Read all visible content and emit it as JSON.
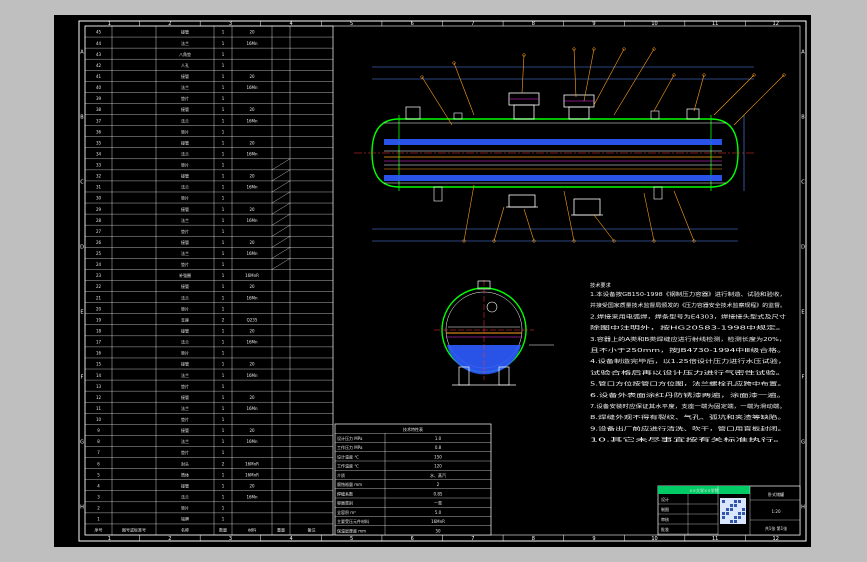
{
  "frame": {
    "columns": [
      "1",
      "2",
      "3",
      "4",
      "5",
      "6",
      "7",
      "8",
      "9",
      "10",
      "11",
      "12"
    ],
    "rows": [
      "A",
      "B",
      "C",
      "D",
      "E",
      "F",
      "G",
      "H"
    ]
  },
  "bom": {
    "header": [
      "序号",
      "图号或标准号",
      "名称",
      "数量",
      "材料",
      "重量",
      "备注"
    ],
    "rows": [
      [
        "45",
        "",
        "接管",
        "1",
        "20",
        "",
        ""
      ],
      [
        "44",
        "",
        "法兰",
        "1",
        "16Mn",
        "",
        ""
      ],
      [
        "43",
        "",
        "八角垫",
        "1",
        "",
        "",
        ""
      ],
      [
        "42",
        "",
        "人孔",
        "1",
        "",
        "",
        ""
      ],
      [
        "41",
        "",
        "接管",
        "1",
        "20",
        "",
        ""
      ],
      [
        "40",
        "",
        "法兰",
        "1",
        "16Mn",
        "",
        ""
      ],
      [
        "39",
        "",
        "垫片",
        "1",
        "",
        "",
        ""
      ],
      [
        "38",
        "",
        "接管",
        "1",
        "20",
        "",
        ""
      ],
      [
        "37",
        "",
        "法兰",
        "1",
        "16Mn",
        "",
        ""
      ],
      [
        "36",
        "",
        "垫片",
        "1",
        "",
        "",
        ""
      ],
      [
        "35",
        "",
        "接管",
        "1",
        "20",
        "",
        ""
      ],
      [
        "34",
        "",
        "法兰",
        "1",
        "16Mn",
        "",
        ""
      ],
      [
        "33",
        "",
        "垫片",
        "1",
        "",
        "",
        ""
      ],
      [
        "32",
        "",
        "接管",
        "1",
        "20",
        "",
        ""
      ],
      [
        "31",
        "",
        "法兰",
        "1",
        "16Mn",
        "",
        ""
      ],
      [
        "30",
        "",
        "垫片",
        "1",
        "",
        "",
        ""
      ],
      [
        "29",
        "",
        "接管",
        "1",
        "20",
        "",
        ""
      ],
      [
        "28",
        "",
        "法兰",
        "1",
        "16Mn",
        "",
        ""
      ],
      [
        "27",
        "",
        "垫片",
        "1",
        "",
        "",
        ""
      ],
      [
        "26",
        "",
        "接管",
        "1",
        "20",
        "",
        ""
      ],
      [
        "25",
        "",
        "法兰",
        "1",
        "16Mn",
        "",
        ""
      ],
      [
        "24",
        "",
        "垫片",
        "1",
        "",
        "",
        ""
      ],
      [
        "23",
        "",
        "补强圈",
        "1",
        "16MnR",
        "",
        ""
      ],
      [
        "22",
        "",
        "接管",
        "1",
        "20",
        "",
        ""
      ],
      [
        "21",
        "",
        "法兰",
        "1",
        "16Mn",
        "",
        ""
      ],
      [
        "20",
        "",
        "垫片",
        "1",
        "",
        "",
        ""
      ],
      [
        "19",
        "",
        "支座",
        "2",
        "Q235",
        "",
        ""
      ],
      [
        "18",
        "",
        "接管",
        "1",
        "20",
        "",
        ""
      ],
      [
        "17",
        "",
        "法兰",
        "1",
        "16Mn",
        "",
        ""
      ],
      [
        "16",
        "",
        "垫片",
        "1",
        "",
        "",
        ""
      ],
      [
        "15",
        "",
        "接管",
        "1",
        "20",
        "",
        ""
      ],
      [
        "14",
        "",
        "法兰",
        "1",
        "16Mn",
        "",
        ""
      ],
      [
        "13",
        "",
        "垫片",
        "1",
        "",
        "",
        ""
      ],
      [
        "12",
        "",
        "接管",
        "1",
        "20",
        "",
        ""
      ],
      [
        "11",
        "",
        "法兰",
        "1",
        "16Mn",
        "",
        ""
      ],
      [
        "10",
        "",
        "垫片",
        "1",
        "",
        "",
        ""
      ],
      [
        "9",
        "",
        "接管",
        "1",
        "20",
        "",
        ""
      ],
      [
        "8",
        "",
        "法兰",
        "1",
        "16Mn",
        "",
        ""
      ],
      [
        "7",
        "",
        "垫片",
        "1",
        "",
        "",
        ""
      ],
      [
        "6",
        "",
        "封头",
        "2",
        "16MnR",
        "",
        ""
      ],
      [
        "5",
        "",
        "筒体",
        "1",
        "16MnR",
        "",
        ""
      ],
      [
        "4",
        "",
        "接管",
        "1",
        "20",
        "",
        ""
      ],
      [
        "3",
        "",
        "法兰",
        "1",
        "16Mn",
        "",
        ""
      ],
      [
        "2",
        "",
        "垫片",
        "1",
        "",
        "",
        ""
      ],
      [
        "1",
        "",
        "铭牌",
        "1",
        "",
        "",
        ""
      ]
    ]
  },
  "notes": {
    "title": "技术要求",
    "lines": [
      "1.本设备按GB150-1998《钢制压力容器》进行制造、试验和验收，",
      "  并接受国家质量技术监督局颁发的《压力容器安全技术监察规程》的监督。",
      "2.焊接采用电弧焊，焊条型号为E4303，焊接接头型式及尺寸",
      "  除图中注明外，按HG20583-1998中规定。",
      "3.容器上的A类和B类焊缝应进行射线检测，检测长度为20%，",
      "  且不小于250mm，按JB4730-1994中Ⅲ级合格。",
      "4.设备制造完毕后，以1.25倍设计压力进行水压试验，",
      "  试验合格后再以设计压力进行气密性试验。",
      "5.管口方位按管口方位图，法兰螺栓孔应跨中布置。",
      "6.设备外表面涂红丹防锈漆两遍，涂面漆一遍。",
      "7.设备安装时应保证其水平度，支座一端为固定端，一端为滑动端。",
      "8.焊缝外观不得有裂纹、气孔、弧坑和夹渣等缺陷。",
      "9.设备出厂前应进行清洗、吹干，管口用盲板封闭。",
      "10.其它未尽事宜按有关标准执行。"
    ]
  },
  "spec": {
    "title": "技术特性表",
    "rows": [
      [
        "设计压力 MPa",
        "1.0"
      ],
      [
        "工作压力 MPa",
        "0.8"
      ],
      [
        "设计温度 ℃",
        "150"
      ],
      [
        "工作温度 ℃",
        "120"
      ],
      [
        "介质",
        "水、蒸汽"
      ],
      [
        "腐蚀裕量 mm",
        "2"
      ],
      [
        "焊缝系数",
        "0.85"
      ],
      [
        "容器类别",
        "一类"
      ],
      [
        "全容积 m³",
        "5.0"
      ],
      [
        "主要受压元件材料",
        "16MnR"
      ],
      [
        "保温层厚度 mm",
        "50"
      ]
    ]
  },
  "titleblock": {
    "header": "××大学××学院",
    "drawing_title": "卧式储罐",
    "scale": "1:20",
    "sheet": "共1张 第1张",
    "rows": [
      "设计",
      "制图",
      "审核",
      "批准"
    ]
  },
  "colors": {
    "border": "#ffffff",
    "shell": "#00ff00",
    "nozzle": "#ffffff",
    "leader": "#ff9f1c",
    "dimension": "#5b8cff",
    "tube": "#4d7dff",
    "internal": "#ff33ff",
    "accent_red": "#ff3333",
    "titlebar": "#00cc66"
  }
}
